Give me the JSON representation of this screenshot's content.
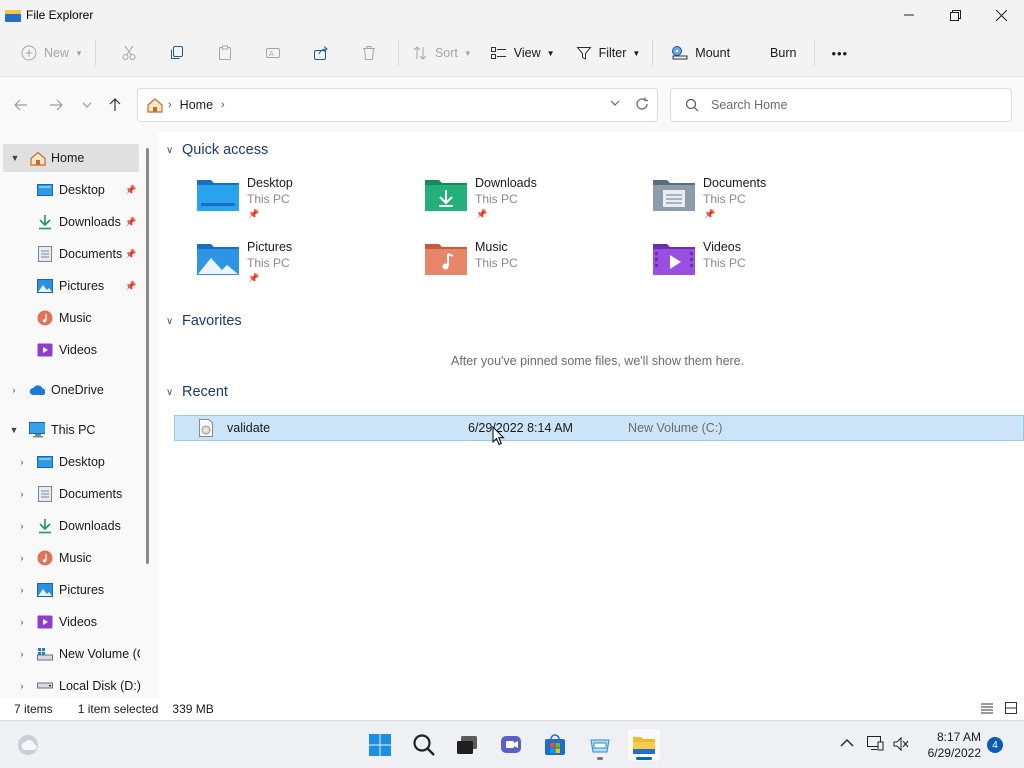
{
  "window": {
    "title": "File Explorer",
    "controls": {
      "minimize": "—",
      "maximize": "❐",
      "close": "✕"
    }
  },
  "toolbar": {
    "new_label": "New",
    "sort_label": "Sort",
    "view_label": "View",
    "filter_label": "Filter",
    "mount_label": "Mount",
    "burn_label": "Burn",
    "more_label": "•••"
  },
  "address": {
    "crumb": "Home",
    "chevron": "›",
    "search_placeholder": "Search Home"
  },
  "sidebar": {
    "home": "Home",
    "pinned": [
      {
        "label": "Desktop",
        "icon": "desktop-icon",
        "pinned": true
      },
      {
        "label": "Downloads",
        "icon": "download-icon",
        "pinned": true
      },
      {
        "label": "Documents",
        "icon": "document-icon",
        "pinned": true
      },
      {
        "label": "Pictures",
        "icon": "picture-icon",
        "pinned": true
      },
      {
        "label": "Music",
        "icon": "music-icon",
        "pinned": false
      },
      {
        "label": "Videos",
        "icon": "video-icon",
        "pinned": false
      }
    ],
    "onedrive": "OneDrive",
    "this_pc": "This PC",
    "pc_items": [
      "Desktop",
      "Documents",
      "Downloads",
      "Music",
      "Pictures",
      "Videos",
      "New Volume (C",
      "Local Disk (D:)"
    ]
  },
  "content": {
    "quick_access": {
      "title": "Quick access",
      "tiles": [
        {
          "name": "Desktop",
          "sub": "This PC",
          "icon": "desktop-folder-icon",
          "pinned": true
        },
        {
          "name": "Downloads",
          "sub": "This PC",
          "icon": "downloads-folder-icon",
          "pinned": true
        },
        {
          "name": "Documents",
          "sub": "This PC",
          "icon": "documents-folder-icon",
          "pinned": true
        },
        {
          "name": "Pictures",
          "sub": "This PC",
          "icon": "pictures-folder-icon",
          "pinned": true
        },
        {
          "name": "Music",
          "sub": "This PC",
          "icon": "music-folder-icon",
          "pinned": false
        },
        {
          "name": "Videos",
          "sub": "This PC",
          "icon": "videos-folder-icon",
          "pinned": false
        }
      ]
    },
    "favorites": {
      "title": "Favorites",
      "empty_message": "After you've pinned some files, we'll show them here."
    },
    "recent": {
      "title": "Recent",
      "items": [
        {
          "name": "validate",
          "date": "6/29/2022 8:14 AM",
          "location": "New Volume (C:)"
        }
      ]
    }
  },
  "status": {
    "item_count": "7 items",
    "selection": "1 item selected",
    "size": "339 MB"
  },
  "taskbar": {
    "time": "8:17 AM",
    "date": "6/29/2022",
    "notification_count": "4",
    "accent": "#0067c0"
  }
}
